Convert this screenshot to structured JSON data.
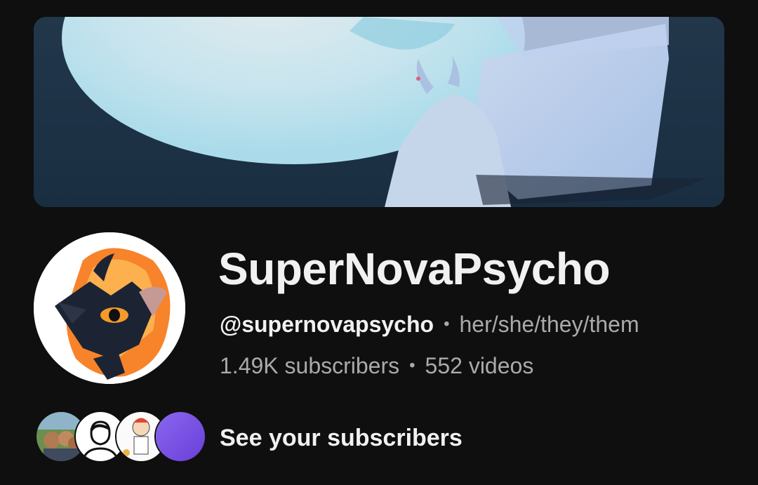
{
  "channel": {
    "name": "SuperNovaPsycho",
    "handle": "@supernovapsycho",
    "pronouns": "her/she/they/them",
    "subscribers": "1.49K subscribers",
    "videos": "552 videos",
    "separator": "•"
  },
  "subscribers_row": {
    "label": "See your subscribers"
  },
  "colors": {
    "background": "#0f0f0f",
    "primary_text": "#f1f1f1",
    "secondary_text": "#aaaaaa"
  }
}
